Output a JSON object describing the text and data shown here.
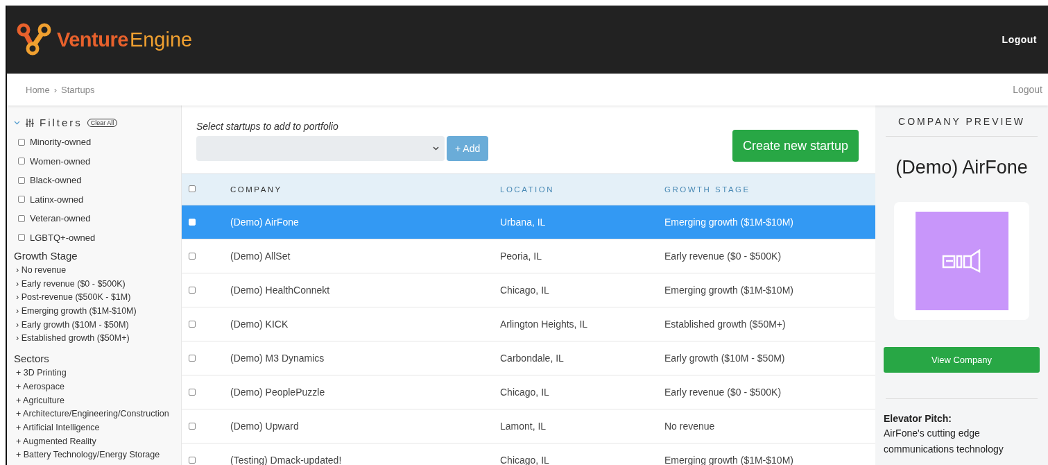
{
  "header": {
    "brand_bold": "Venture",
    "brand_light": "Engine",
    "logout": "Logout"
  },
  "breadcrumb": {
    "items": [
      "Home",
      "Startups"
    ],
    "separator": "›",
    "logout": "Logout"
  },
  "filters": {
    "title": "Filters",
    "expanded": true,
    "clear": "Clear All",
    "checkboxes": [
      {
        "label": "Minority-owned",
        "checked": false
      },
      {
        "label": "Women-owned",
        "checked": false
      },
      {
        "label": "Black-owned",
        "checked": false
      },
      {
        "label": "Latinx-owned",
        "checked": false
      },
      {
        "label": "Veteran-owned",
        "checked": false
      },
      {
        "label": "LGBTQ+-owned",
        "checked": false
      }
    ],
    "groups": [
      {
        "title": "Growth Stage",
        "bullet": "›",
        "items": [
          "No revenue",
          "Early revenue ($0 - $500K)",
          "Post-revenue ($500K - $1M)",
          "Emerging growth ($1M-$10M)",
          "Early growth ($10M - $50M)",
          "Established growth ($50M+)"
        ]
      },
      {
        "title": "Sectors",
        "bullet": "+",
        "items": [
          "3D Printing",
          "Aerospace",
          "Agriculture",
          "Architecture/Engineering/Construction",
          "Artificial Intelligence",
          "Augmented Reality",
          "Battery Technology/Energy Storage"
        ]
      }
    ]
  },
  "portfolio": {
    "label": "Select startups to add to portfolio",
    "add": "+ Add",
    "create": "Create new startup"
  },
  "table": {
    "all_checked": false,
    "columns": [
      "COMPANY",
      "LOCATION",
      "GROWTH STAGE"
    ],
    "rows": [
      {
        "company": "(Demo) AirFone",
        "location": "Urbana, IL",
        "stage": "Emerging growth ($1M-$10M)",
        "selected": true,
        "checked": false
      },
      {
        "company": "(Demo) AllSet",
        "location": "Peoria, IL",
        "stage": "Early revenue ($0 - $500K)",
        "selected": false,
        "checked": false
      },
      {
        "company": "(Demo) HealthConnekt",
        "location": "Chicago, IL",
        "stage": "Emerging growth ($1M-$10M)",
        "selected": false,
        "checked": false
      },
      {
        "company": "(Demo) KICK",
        "location": "Arlington Heights, IL",
        "stage": "Established growth ($50M+)",
        "selected": false,
        "checked": false
      },
      {
        "company": "(Demo) M3 Dynamics",
        "location": "Carbondale, IL",
        "stage": "Early growth ($10M - $50M)",
        "selected": false,
        "checked": false
      },
      {
        "company": "(Demo) PeoplePuzzle",
        "location": "Chicago, IL",
        "stage": "Early revenue ($0 - $500K)",
        "selected": false,
        "checked": false
      },
      {
        "company": "(Demo) Upward",
        "location": "Lamont, IL",
        "stage": "No revenue",
        "selected": false,
        "checked": false
      },
      {
        "company": "(Testing) Dmack-updated!",
        "location": "Chicago, IL",
        "stage": "Emerging growth ($1M-$10M)",
        "selected": false,
        "checked": false
      }
    ]
  },
  "preview": {
    "heading": "COMPANY PREVIEW",
    "name": "(Demo) AirFone",
    "button": "View Company",
    "pitch_label": "Elevator Pitch:",
    "pitch": "AirFone's cutting edge communications technology"
  }
}
